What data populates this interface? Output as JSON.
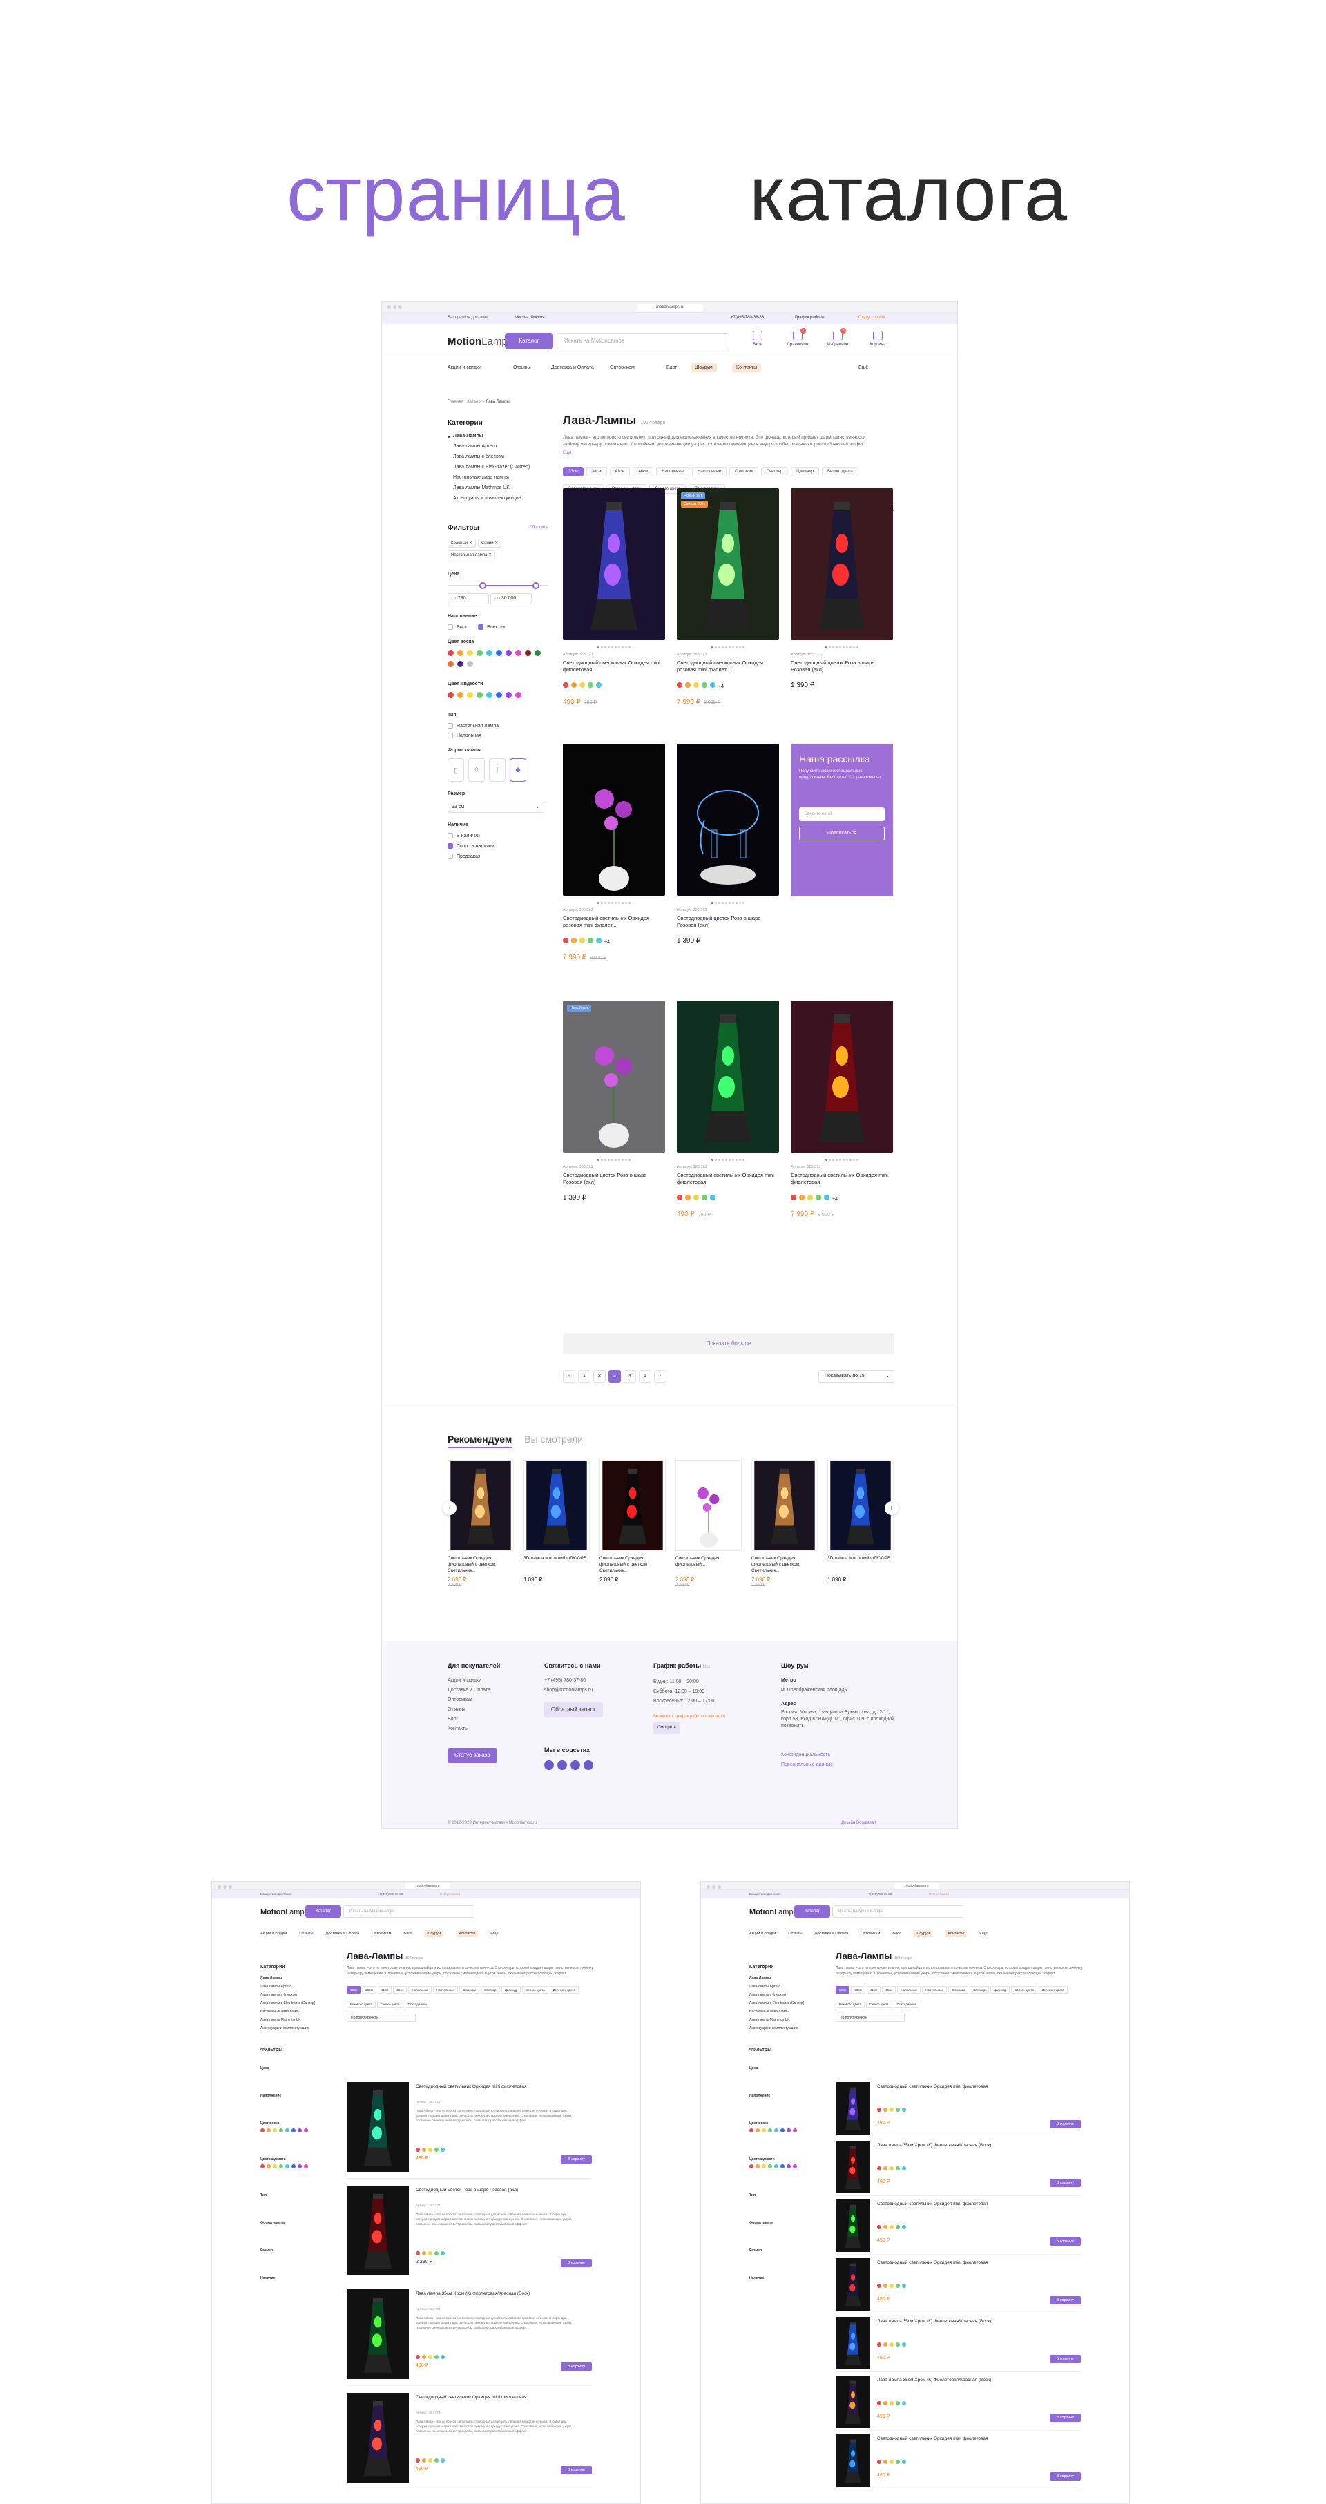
{
  "hero": {
    "word1": "страница",
    "word2": "каталога"
  },
  "browser": {
    "url": "motionlamps.ru"
  },
  "topbar": {
    "city_prefix": "Ваш регион доставки:",
    "city": "Москва, Россия",
    "phone": "+7(495)780-38-88",
    "hours": "График работы",
    "status": "Статус заказа"
  },
  "header": {
    "logo_a": "Motion",
    "logo_b": "Lamps",
    "catalog": "Каталог",
    "search_placeholder": "Искать на MotionLamps",
    "icons": [
      {
        "label": "Вход",
        "icon": "user-icon"
      },
      {
        "label": "Сравнение",
        "icon": "compare-icon",
        "badge": "1"
      },
      {
        "label": "Избранное",
        "icon": "heart-icon",
        "badge": "2"
      },
      {
        "label": "Корзина",
        "icon": "cart-icon"
      }
    ]
  },
  "nav": {
    "items": [
      "Акции и скидки",
      "Отзывы",
      "Доставка и Оплата",
      "Оптовикам",
      "Блог",
      "Шоурум",
      "Контакты",
      "Ещё"
    ]
  },
  "breadcrumbs": [
    "Главная",
    "Каталог",
    "Лава Лампы"
  ],
  "sidebar": {
    "categories_title": "Категории",
    "categories": [
      "Лава-Лампы",
      "Лава лампы Артего",
      "Лава лампы с блеском",
      "Лава лампы с Elek-trazer (Сантер)",
      "Настольные лава лампы",
      "Лава лампы Mathmos UK",
      "Аксессуары и комплектующие"
    ],
    "filters_title": "Фильтры",
    "reset": "Сбросить",
    "chips": [
      "Красный",
      "Синий",
      "Настольная лампа"
    ],
    "price_title": "Цена",
    "price_from": "790",
    "price_to": "30 000",
    "price_from_label": "от",
    "price_to_label": "до",
    "fill_title": "Наполнение",
    "fill_options": [
      "Воск",
      "Блестки"
    ],
    "wax_title": "Цвет воска",
    "liquid_title": "Цвет жидкости",
    "type_title": "Тип",
    "type_options": [
      "Настольная лампа",
      "Напольная"
    ],
    "shape_title": "Форма лампы",
    "size_title": "Размер",
    "size_value": "33 см",
    "stock_title": "Наличие",
    "stock_options": [
      "В наличии",
      "Скоро в наличии",
      "Предзаказ"
    ]
  },
  "catalog": {
    "title": "Лава-Лампы",
    "count": "102 товара",
    "description": "Лава лампа – это не просто светильник, пригодный для использования в качестве ночника. Это фонарь, который придает шарм таинственности любому интерьеру помещению. Спокойные, успокаивающие узоры, постоянно сменяющиеся внутри колбы, оказывают расслабляющий эффект.",
    "more": "Ещё",
    "tags": [
      "33см",
      "38см",
      "41см",
      "46см",
      "Напольные",
      "Настольные",
      "С воском",
      "Светлер",
      "Цилиндр",
      "Белого цвета",
      "Зеленого цвета",
      "Розового цвета",
      "Синего цвета",
      "Психоделики"
    ],
    "sort": "По популярности",
    "load_more": "Показать больше",
    "pages": [
      "‹",
      "1",
      "2",
      "3",
      "4",
      "5",
      "›"
    ],
    "per_page": "Показывать по 15"
  },
  "products": [
    {
      "sku": "Артикул: 383 373",
      "name": "Светодиодный светильник Орхидея mini фиолетовая",
      "price": "490 ₽",
      "old": "780 ₽",
      "sale": true,
      "bg": "#1a1230",
      "badges": []
    },
    {
      "sku": "Артикул: 383 373",
      "name": "Светодиодный светильник Орхидея розовая mini фиолет...",
      "price": "7 990 ₽",
      "old": "8 900 ₽",
      "sale": true,
      "bg": "#1d2418",
      "badges": [
        "Новый хит",
        "Скидка 30%"
      ],
      "more": "+4"
    },
    {
      "sku": "Артикул: 383 373",
      "name": "Светодиодный цветок Роза в шаре Розовая (акл)",
      "price": "1 390 ₽",
      "old": "",
      "sale": false,
      "bg": "#3a1a1e",
      "badges": []
    },
    {
      "sku": "Артикул: 383 373",
      "name": "Светодиодный светильник Орхидея розовая mini фиолет...",
      "price": "7 990 ₽",
      "old": "8 900 ₽",
      "sale": true,
      "bg": "#050505",
      "badges": [],
      "more": "+4"
    },
    {
      "sku": "Артикул: 383 373",
      "name": "Светодиодный цветок Роза в шаре Розовая (акл)",
      "price": "1 390 ₽",
      "old": "",
      "sale": false,
      "bg": "#06060c",
      "badges": []
    },
    {
      "sku": "Артикул: 383 373",
      "name": "Светодиодный цветок Роза в шаре Розовая (акл)",
      "price": "1 390 ₽",
      "old": "",
      "sale": false,
      "bg": "#6c6c70",
      "badges": [
        "Новый хит"
      ]
    },
    {
      "sku": "Артикул: 383 373",
      "name": "Светодиодный светильник Орхидея mini фиолетовая",
      "price": "490 ₽",
      "old": "780 ₽",
      "sale": true,
      "bg": "#0f3020",
      "badges": []
    },
    {
      "sku": "Артикул: 383 373",
      "name": "Светодиодный светильник Орхидея mini фиолетовая",
      "price": "7 990 ₽",
      "old": "8 900 ₽",
      "sale": true,
      "bg": "#3a1220",
      "badges": [],
      "more": "+4"
    }
  ],
  "newsletter": {
    "title": "Наша рассылка",
    "text": "Получайте акции и специальные предложения. Бесплатно 1-2 раза в месяц",
    "placeholder": "Введите email",
    "button": "Подписаться"
  },
  "reco": {
    "tab1": "Рекомендуем",
    "tab2": "Вы смотрели",
    "items": [
      {
        "name": "Светильник Орхидея фиолетовый с цветком Светильник...",
        "price": "2 090 ₽",
        "old": "2 490 ₽",
        "sale": true,
        "bg": "#1a1420"
      },
      {
        "name": "3D-лампа Мигтилий ФЛЮОРЕ",
        "price": "1 090 ₽",
        "old": "",
        "sale": false,
        "bg": "#0b1028"
      },
      {
        "name": "Светильник Орхидея фиолетовый с цветком Светильник...",
        "price": "2 090 ₽",
        "old": "",
        "sale": false,
        "bg": "#200808"
      },
      {
        "name": "Светильник Орхидея фиолетовый...",
        "price": "2 090 ₽",
        "old": "2 490 ₽",
        "sale": true,
        "bg": "#ffffff"
      },
      {
        "name": "Светильник Орхидея фиолетовый с цветком Светильник...",
        "price": "2 090 ₽",
        "old": "2 490 ₽",
        "sale": true,
        "bg": "#1a1420"
      },
      {
        "name": "3D-лампа Мигтилий ФЛЮОРЕ",
        "price": "1 090 ₽",
        "old": "",
        "sale": false,
        "bg": "#0b1028"
      }
    ]
  },
  "footer": {
    "col1_title": "Для покупателей",
    "col1": [
      "Акции и скидки",
      "Доставка и Оплата",
      "Оптовикам",
      "Отзывы",
      "Блог",
      "Контакты"
    ],
    "status_btn": "Статус заказа",
    "col2_title": "Свяжитесь с нами",
    "col2": [
      "+7 (495) 780-37-80",
      "shop@motionlamps.ru"
    ],
    "callback": "Обратный звонок",
    "social_title": "Мы в соцсетях",
    "col3_title": "График работы",
    "col3_sub": "Мск",
    "col3": [
      "Будни: 11:00 – 20:00",
      "Суббота: 12:00 – 19:00",
      "Воскресенье: 12:00 – 17:00"
    ],
    "col3_note": "Возможно, график работы изменится",
    "col3_btn": "Смотреть",
    "col4_title": "Шоу-рум",
    "metro_label": "Метро",
    "metro": "м. Преображенская площадь",
    "addr_label": "Адрес",
    "addr": "Россия, Москва, 1-ая улица Бухвостова, д.12/11, корп.53, вход в \"НАРДОМ\", офис 109, с проходной позвонить",
    "links": [
      "Конфиденциальность",
      "Персональные данные"
    ],
    "copyright": "© 2012-2020 Интернет-магазин Motionlamps.ru",
    "design": "Дизайн Douglasart"
  },
  "list_view": {
    "rows": [
      {
        "name": "Светодиодный светильник Орхидея mini фиолетовая",
        "sku": "Артикул: 383 373",
        "price": "490 ₽",
        "old": "1 690 ₽",
        "sale": true,
        "button": "В корзину"
      },
      {
        "name": "Светодиодный цветок Роза в шаре Розовая (акл)",
        "sku": "Артикул: 383 373",
        "price": "2 290 ₽",
        "old": "",
        "sale": false,
        "button": "В корзине"
      },
      {
        "name": "Лава лампа 35см Хром (К) Фиолетовая/Красная (Воск)",
        "sku": "Артикул: 383 373",
        "price": "490 ₽",
        "old": "1 690 ₽",
        "sale": true,
        "button": "В корзину"
      },
      {
        "name": "Светодиодный светильник Орхидея mini фиолетовая",
        "sku": "Артикул: 383 373",
        "price": "490 ₽",
        "old": "1 690 ₽",
        "sale": true,
        "button": "В корзине"
      }
    ]
  },
  "compact_view": {
    "rows": [
      {
        "name": "Светодиодный светильник Орхидея mini фиолетовая",
        "price": "490 ₽",
        "button": "В корзине"
      },
      {
        "name": "Лава лампа 35см Хром (К) Фиолетовая/Красная (Воск)",
        "price": "490 ₽",
        "button": "В корзину"
      },
      {
        "name": "Светодиодный светильник Орхидея mini фиолетовая",
        "price": "490 ₽",
        "button": "В корзине"
      },
      {
        "name": "Светодиодный светильник Орхидея mini фиолетовая",
        "price": "490 ₽",
        "button": "В корзину"
      },
      {
        "name": "Лава лампа 35см Хром (К) Фиолетовая/Красная (Воск)",
        "price": "490 ₽",
        "button": "В корзине"
      },
      {
        "name": "Лава лампа 35см Хром (К) Фиолетовая/Красная (Воск)",
        "price": "490 ₽",
        "button": "В корзину"
      },
      {
        "name": "Светодиодный светильник Орхидея mini фиолетовая",
        "price": "490 ₽",
        "button": "В корзину"
      }
    ]
  },
  "colors": {
    "accent": "#8e6ad7",
    "sale": "#f08a38",
    "swatches": [
      "#e84a4a",
      "#f0a43a",
      "#f5d64a",
      "#6ecf6e",
      "#4ac4e0",
      "#3a6ee0",
      "#9a4ae0",
      "#e04ac4",
      "#7a1e1e",
      "#2a8a4a"
    ]
  }
}
